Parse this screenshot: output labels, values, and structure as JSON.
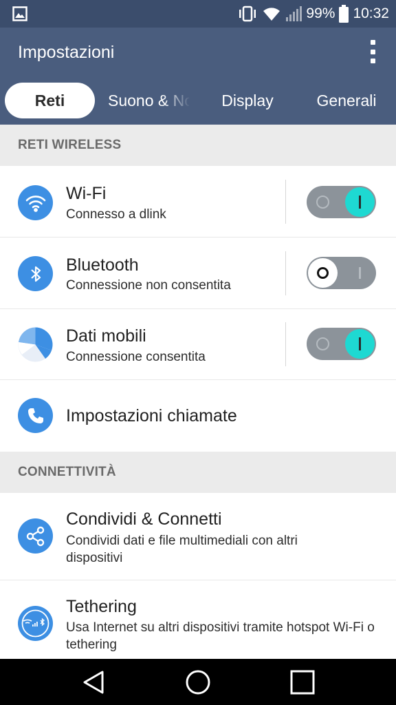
{
  "status_bar": {
    "battery": "99%",
    "time": "10:32",
    "icons": [
      "image-notification-icon",
      "vibrate-icon",
      "wifi-signal-icon",
      "cell-signal-icon",
      "battery-icon"
    ]
  },
  "app_bar": {
    "title": "Impostazioni",
    "menu_icon": "overflow-menu-icon"
  },
  "tabs": [
    {
      "label": "Reti",
      "active": true
    },
    {
      "label": "Suono & Notifiche",
      "active": false
    },
    {
      "label": "Display",
      "active": false
    },
    {
      "label": "Generali",
      "active": false
    }
  ],
  "sections": [
    {
      "header": "RETI WIRELESS"
    },
    {
      "header": "CONNETTIVITÀ"
    }
  ],
  "rows": {
    "wifi": {
      "title": "Wi-Fi",
      "subtitle": "Connesso a dlink",
      "icon": "wifi-icon",
      "toggle": "on"
    },
    "bluetooth": {
      "title": "Bluetooth",
      "subtitle": "Connessione non consentita",
      "icon": "bluetooth-icon",
      "toggle": "off"
    },
    "mobile_data": {
      "title": "Dati mobili",
      "subtitle": "Connessione consentita",
      "icon": "mobile-data-icon",
      "toggle": "on"
    },
    "call_settings": {
      "title": "Impostazioni chiamate",
      "icon": "phone-icon"
    },
    "share_connect": {
      "title": "Condividi & Connetti",
      "subtitle": "Condividi dati e file multimediali con altri dispositivi",
      "icon": "share-icon"
    },
    "tethering": {
      "title": "Tethering",
      "subtitle": "Usa Internet su altri dispositivi tramite hotspot Wi-Fi o tethering",
      "icon": "tethering-icon"
    }
  },
  "colors": {
    "status_bar": "#3b4d6c",
    "app_bar": "#4a5d7e",
    "icon_blue": "#3d8fe3",
    "toggle_on": "#1ed9d2",
    "toggle_track": "#8c939a",
    "section_bg": "#ebebeb"
  },
  "nav_bar": {
    "buttons": [
      "back-icon",
      "home-icon",
      "recents-icon"
    ]
  }
}
